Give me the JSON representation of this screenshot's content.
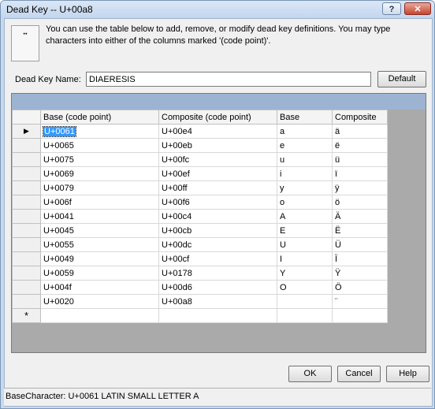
{
  "window": {
    "title": "Dead Key -- U+00a8"
  },
  "titlebar": {
    "help_glyph": "?",
    "close_glyph": "✕"
  },
  "dead_key_glyph": "¨",
  "instructions": "You can use the table below to add, remove, or modify dead key definitions. You may type characters into either of the columns marked '(code point)'.",
  "dead_key_name": {
    "label": "Dead Key Name:",
    "value": "DIAERESIS"
  },
  "buttons": {
    "default": "Default",
    "ok": "OK",
    "cancel": "Cancel",
    "help": "Help"
  },
  "grid": {
    "columns": [
      "Base  (code point)",
      "Composite  (code point)",
      "Base",
      "Composite"
    ],
    "current_row_marker": "▶",
    "new_row_marker": "*",
    "rows": [
      [
        "U+0061",
        "U+00e4",
        "a",
        "ä"
      ],
      [
        "U+0065",
        "U+00eb",
        "e",
        "ë"
      ],
      [
        "U+0075",
        "U+00fc",
        "u",
        "ü"
      ],
      [
        "U+0069",
        "U+00ef",
        "i",
        "ï"
      ],
      [
        "U+0079",
        "U+00ff",
        "y",
        "ÿ"
      ],
      [
        "U+006f",
        "U+00f6",
        "o",
        "ö"
      ],
      [
        "U+0041",
        "U+00c4",
        "A",
        "Ä"
      ],
      [
        "U+0045",
        "U+00cb",
        "E",
        "Ë"
      ],
      [
        "U+0055",
        "U+00dc",
        "U",
        "Ü"
      ],
      [
        "U+0049",
        "U+00cf",
        "I",
        "Ï"
      ],
      [
        "U+0059",
        "U+0178",
        "Y",
        "Ÿ"
      ],
      [
        "U+004f",
        "U+00d6",
        "O",
        "Ö"
      ],
      [
        "U+0020",
        "U+00a8",
        "",
        "¨"
      ]
    ]
  },
  "status_bar": {
    "text": "BaseCharacter: U+0061  LATIN SMALL LETTER A"
  }
}
